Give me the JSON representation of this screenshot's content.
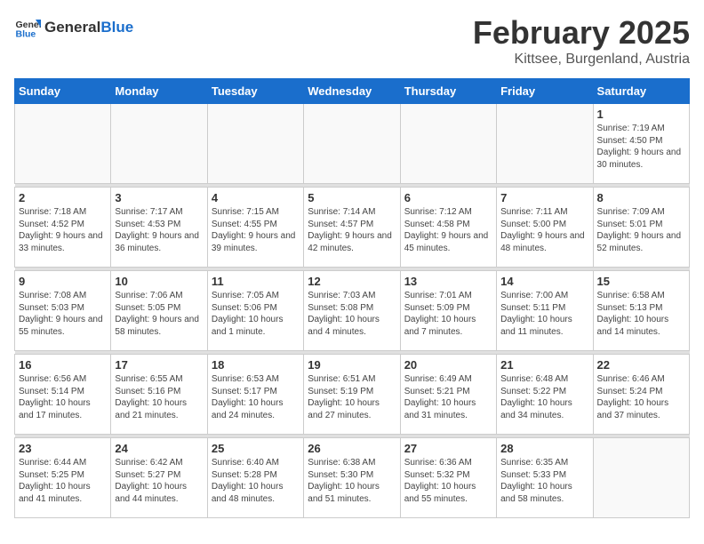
{
  "logo": {
    "general": "General",
    "blue": "Blue"
  },
  "title": "February 2025",
  "subtitle": "Kittsee, Burgenland, Austria",
  "headers": [
    "Sunday",
    "Monday",
    "Tuesday",
    "Wednesday",
    "Thursday",
    "Friday",
    "Saturday"
  ],
  "weeks": [
    [
      {
        "day": "",
        "info": ""
      },
      {
        "day": "",
        "info": ""
      },
      {
        "day": "",
        "info": ""
      },
      {
        "day": "",
        "info": ""
      },
      {
        "day": "",
        "info": ""
      },
      {
        "day": "",
        "info": ""
      },
      {
        "day": "1",
        "info": "Sunrise: 7:19 AM\nSunset: 4:50 PM\nDaylight: 9 hours and 30 minutes."
      }
    ],
    [
      {
        "day": "2",
        "info": "Sunrise: 7:18 AM\nSunset: 4:52 PM\nDaylight: 9 hours and 33 minutes."
      },
      {
        "day": "3",
        "info": "Sunrise: 7:17 AM\nSunset: 4:53 PM\nDaylight: 9 hours and 36 minutes."
      },
      {
        "day": "4",
        "info": "Sunrise: 7:15 AM\nSunset: 4:55 PM\nDaylight: 9 hours and 39 minutes."
      },
      {
        "day": "5",
        "info": "Sunrise: 7:14 AM\nSunset: 4:57 PM\nDaylight: 9 hours and 42 minutes."
      },
      {
        "day": "6",
        "info": "Sunrise: 7:12 AM\nSunset: 4:58 PM\nDaylight: 9 hours and 45 minutes."
      },
      {
        "day": "7",
        "info": "Sunrise: 7:11 AM\nSunset: 5:00 PM\nDaylight: 9 hours and 48 minutes."
      },
      {
        "day": "8",
        "info": "Sunrise: 7:09 AM\nSunset: 5:01 PM\nDaylight: 9 hours and 52 minutes."
      }
    ],
    [
      {
        "day": "9",
        "info": "Sunrise: 7:08 AM\nSunset: 5:03 PM\nDaylight: 9 hours and 55 minutes."
      },
      {
        "day": "10",
        "info": "Sunrise: 7:06 AM\nSunset: 5:05 PM\nDaylight: 9 hours and 58 minutes."
      },
      {
        "day": "11",
        "info": "Sunrise: 7:05 AM\nSunset: 5:06 PM\nDaylight: 10 hours and 1 minute."
      },
      {
        "day": "12",
        "info": "Sunrise: 7:03 AM\nSunset: 5:08 PM\nDaylight: 10 hours and 4 minutes."
      },
      {
        "day": "13",
        "info": "Sunrise: 7:01 AM\nSunset: 5:09 PM\nDaylight: 10 hours and 7 minutes."
      },
      {
        "day": "14",
        "info": "Sunrise: 7:00 AM\nSunset: 5:11 PM\nDaylight: 10 hours and 11 minutes."
      },
      {
        "day": "15",
        "info": "Sunrise: 6:58 AM\nSunset: 5:13 PM\nDaylight: 10 hours and 14 minutes."
      }
    ],
    [
      {
        "day": "16",
        "info": "Sunrise: 6:56 AM\nSunset: 5:14 PM\nDaylight: 10 hours and 17 minutes."
      },
      {
        "day": "17",
        "info": "Sunrise: 6:55 AM\nSunset: 5:16 PM\nDaylight: 10 hours and 21 minutes."
      },
      {
        "day": "18",
        "info": "Sunrise: 6:53 AM\nSunset: 5:17 PM\nDaylight: 10 hours and 24 minutes."
      },
      {
        "day": "19",
        "info": "Sunrise: 6:51 AM\nSunset: 5:19 PM\nDaylight: 10 hours and 27 minutes."
      },
      {
        "day": "20",
        "info": "Sunrise: 6:49 AM\nSunset: 5:21 PM\nDaylight: 10 hours and 31 minutes."
      },
      {
        "day": "21",
        "info": "Sunrise: 6:48 AM\nSunset: 5:22 PM\nDaylight: 10 hours and 34 minutes."
      },
      {
        "day": "22",
        "info": "Sunrise: 6:46 AM\nSunset: 5:24 PM\nDaylight: 10 hours and 37 minutes."
      }
    ],
    [
      {
        "day": "23",
        "info": "Sunrise: 6:44 AM\nSunset: 5:25 PM\nDaylight: 10 hours and 41 minutes."
      },
      {
        "day": "24",
        "info": "Sunrise: 6:42 AM\nSunset: 5:27 PM\nDaylight: 10 hours and 44 minutes."
      },
      {
        "day": "25",
        "info": "Sunrise: 6:40 AM\nSunset: 5:28 PM\nDaylight: 10 hours and 48 minutes."
      },
      {
        "day": "26",
        "info": "Sunrise: 6:38 AM\nSunset: 5:30 PM\nDaylight: 10 hours and 51 minutes."
      },
      {
        "day": "27",
        "info": "Sunrise: 6:36 AM\nSunset: 5:32 PM\nDaylight: 10 hours and 55 minutes."
      },
      {
        "day": "28",
        "info": "Sunrise: 6:35 AM\nSunset: 5:33 PM\nDaylight: 10 hours and 58 minutes."
      },
      {
        "day": "",
        "info": ""
      }
    ]
  ]
}
